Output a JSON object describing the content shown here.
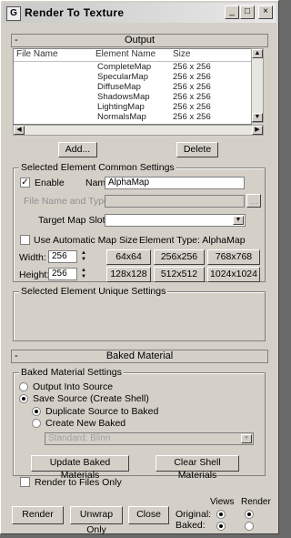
{
  "window": {
    "title": "Render To Texture"
  },
  "output": {
    "header": "Output",
    "columns": [
      "File Name",
      "Element Name",
      "Size"
    ],
    "rows": [
      {
        "element": "CompleteMap",
        "size": "256 x 256"
      },
      {
        "element": "SpecularMap",
        "size": "256 x 256"
      },
      {
        "element": "DiffuseMap",
        "size": "256 x 256"
      },
      {
        "element": "ShadowsMap",
        "size": "256 x 256"
      },
      {
        "element": "LightingMap",
        "size": "256 x 256"
      },
      {
        "element": "NormalsMap",
        "size": "256 x 256"
      }
    ],
    "add_label": "Add...",
    "delete_label": "Delete"
  },
  "common": {
    "legend": "Selected Element Common Settings",
    "enable_label": "Enable",
    "enable_checked": true,
    "name_label": "Name:",
    "name_value": "AlphaMap",
    "file_label": "File Name and Type:",
    "file_btn": "...",
    "target_label": "Target Map Slot:",
    "auto_size_label": "Use Automatic Map Size",
    "element_type": "Element Type: AlphaMap",
    "width_label": "Width:",
    "width_value": "256",
    "height_label": "Height:",
    "height_value": "256",
    "size_buttons": [
      "64x64",
      "256x256",
      "768x768",
      "128x128",
      "512x512",
      "1024x1024"
    ]
  },
  "unique": {
    "legend": "Selected Element Unique Settings"
  },
  "baked": {
    "header": "Baked Material",
    "legend": "Baked Material Settings",
    "output_into_source": "Output Into Source",
    "save_source": "Save Source (Create Shell)",
    "duplicate_source": "Duplicate Source to Baked",
    "create_new": "Create New Baked",
    "combo_value": "Standard: Blinn",
    "update_label": "Update Baked Materials",
    "clear_label": "Clear Shell Materials",
    "render_files_only": "Render to Files Only"
  },
  "footer": {
    "render": "Render",
    "unwrap": "Unwrap Only",
    "close": "Close",
    "original": "Original:",
    "baked": "Baked:",
    "views_label": "Views",
    "render_label": "Render"
  }
}
